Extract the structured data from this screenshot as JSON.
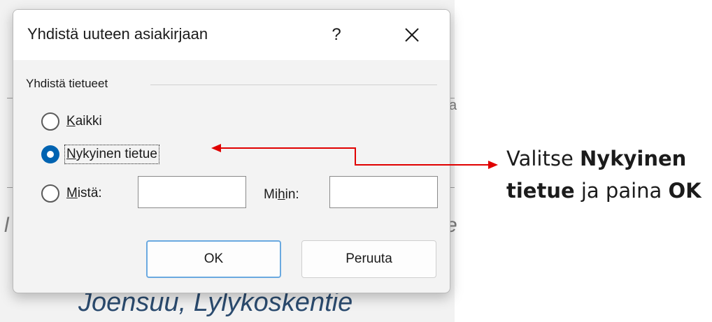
{
  "dialog": {
    "title": "Yhdistä uuteen asiakirjaan",
    "help_symbol": "?",
    "close_icon": "close-icon",
    "group_label": "Yhdistä tietueet",
    "options": [
      {
        "access_key": "K",
        "rest": "aikki",
        "checked": false
      },
      {
        "access_key": "N",
        "rest": "ykyinen tietue",
        "checked": true
      },
      {
        "access_key": "M",
        "rest": "istä:",
        "checked": false
      }
    ],
    "from_value": "",
    "to_label_pre": "Mi",
    "to_label_key": "h",
    "to_label_post": "in:",
    "to_value": "",
    "ok_label": "OK",
    "cancel_label": "Peruuta",
    "accent_color": "#0063b1"
  },
  "background": {
    "partial_text": "Joensuu, Lylykoskentie",
    "stray_left": "l",
    "stray_right": "e",
    "stray_right_top": "a"
  },
  "callout": {
    "pre": "Valitse ",
    "bold1": "Nykyinen tietue",
    "mid": " ja paina ",
    "bold2": "OK",
    "arrow_color": "#e00000"
  }
}
